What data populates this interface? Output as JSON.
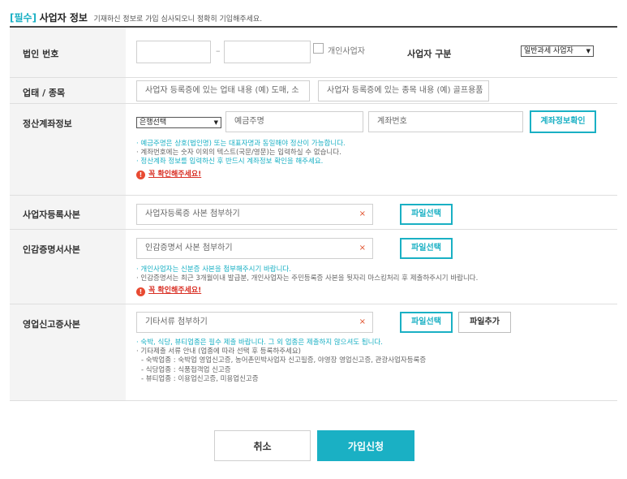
{
  "header": {
    "required_tag": "[필수]",
    "title": "사업자 정보",
    "description": "기재하신 정보로 가입 심사되오니 정확히 기입해주세요."
  },
  "rows": {
    "corp_number": {
      "label": "법인 번호",
      "part1_value": "",
      "part2_value": "",
      "dash": "–",
      "individual_checkbox_label": "개인사업자",
      "business_type_label": "사업자 구분",
      "business_type_selected": "일반과세 사업자"
    },
    "industry": {
      "label": "업태 / 종목",
      "type_placeholder": "사업자 등록증에 있는 업태 내용 (예) 도매, 소",
      "item_placeholder": "사업자 등록증에 있는 종목 내용 (예) 골프용품"
    },
    "account": {
      "label": "정산계좌정보",
      "bank_selected": "은행선택",
      "holder_placeholder": "예금주명",
      "number_placeholder": "계좌번호",
      "verify_button": "계좌정보확인",
      "notes": [
        "· 예금주명은 상호(법인명) 또는 대표자명과 동일해야 정산이 가능합니다.",
        "· 계좌번호에는 숫자 이외의 텍스트(국문/영문)는 입력하실 수 없습니다.",
        "· 정산계좌 정보를 입력하신 후 반드시 계좌정보 확인을 해주세요."
      ],
      "warning": "꼭 확인해주세요!"
    },
    "biz_reg_copy": {
      "label": "사업자등록사본",
      "placeholder": "사업자등록증 사본 첨부하기",
      "remove": "×",
      "file_button": "파일선택"
    },
    "seal_cert": {
      "label": "인감증명서사본",
      "placeholder": "인감증명서 사본 첨부하기",
      "remove": "×",
      "file_button": "파일선택",
      "notes": [
        "· 개인사업자는 신분증 사본을 첨부해주시기 바랍니다.",
        "· 인감증명서는 최근 3개월이내 발급분, 개인사업자는 주민등록증 사본을 뒷자리 마스킹처리 후 제출하주시기 바랍니다."
      ],
      "warning": "꼭 확인해주세요!"
    },
    "business_report": {
      "label": "영업신고증사본",
      "placeholder": "기타서류 첨부하기",
      "remove": "×",
      "file_button": "파일선택",
      "add_button": "파일추가",
      "notes": [
        "· 숙박, 식당, 뷰티업종은 필수 제출 바랍니다. 그 외 업종은 제출하지 않으셔도 됩니다.",
        "· 기타제출 서류 안내 (업종에 따라 선택 후 등록하주세요)",
        "- 숙박업종 : 숙박업 영업신고증, 농어촌민박사업자 신고필증, 야영장 영업신고증, 관광사업자등록증",
        "- 식당업종 : 식품접객업 신고증",
        "- 뷰티업종 : 이용업신고증, 미용업신고증"
      ]
    }
  },
  "actions": {
    "cancel": "취소",
    "submit": "가입신청"
  },
  "colors": {
    "accent": "#1ab0c4",
    "warning": "#e84a32",
    "label_bg": "#f4f4f4"
  }
}
